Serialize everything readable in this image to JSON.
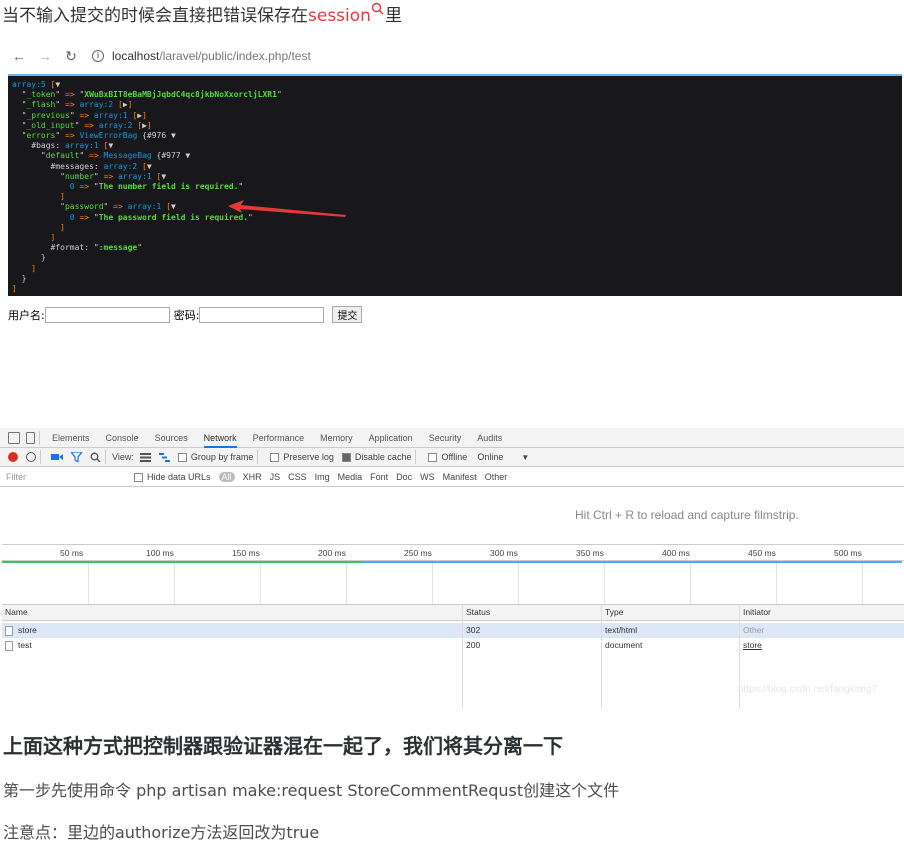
{
  "intro": {
    "text": "当不输入提交的时候会直接把错误保存在",
    "keyword": "session",
    "suffix": "里"
  },
  "browser": {
    "url_host": "localhost",
    "url_path": "/laravel/public/index.php/test"
  },
  "dump": {
    "lines": [
      [
        [
          "note",
          "array:5 "
        ],
        [
          "pun",
          "["
        ],
        [
          "wt",
          "▼"
        ]
      ],
      [
        [
          "wt",
          "  \""
        ],
        [
          "key",
          "_token"
        ],
        [
          "wt",
          "\" "
        ],
        [
          "op",
          "=>"
        ],
        [
          "wt",
          " \""
        ],
        [
          "str",
          "XWuBxBIT8eBaMBjJqbdC4qc8jkbNoXxorcljLXR1"
        ],
        [
          "wt",
          "\""
        ]
      ],
      [
        [
          "wt",
          "  \""
        ],
        [
          "key",
          "_flash"
        ],
        [
          "wt",
          "\" "
        ],
        [
          "op",
          "=>"
        ],
        [
          "note",
          " array:2 "
        ],
        [
          "pun",
          "["
        ],
        [
          "wt",
          "▶"
        ],
        [
          "pun",
          "]"
        ]
      ],
      [
        [
          "wt",
          "  \""
        ],
        [
          "key",
          "_previous"
        ],
        [
          "wt",
          "\" "
        ],
        [
          "op",
          "=>"
        ],
        [
          "note",
          " array:1 "
        ],
        [
          "pun",
          "["
        ],
        [
          "wt",
          "▶"
        ],
        [
          "pun",
          "]"
        ]
      ],
      [
        [
          "wt",
          "  \""
        ],
        [
          "key",
          "_old_input"
        ],
        [
          "wt",
          "\" "
        ],
        [
          "op",
          "=>"
        ],
        [
          "note",
          " array:2 "
        ],
        [
          "pun",
          "["
        ],
        [
          "wt",
          "▶"
        ],
        [
          "pun",
          "]"
        ]
      ],
      [
        [
          "wt",
          "  \""
        ],
        [
          "key",
          "errors"
        ],
        [
          "wt",
          "\" "
        ],
        [
          "op",
          "=>"
        ],
        [
          "note",
          " ViewErrorBag "
        ],
        [
          "wt",
          "{#976 ▼"
        ]
      ],
      [
        [
          "wt",
          "    #bags: "
        ],
        [
          "note",
          "array:1 "
        ],
        [
          "pun",
          "["
        ],
        [
          "wt",
          "▼"
        ]
      ],
      [
        [
          "wt",
          "      \""
        ],
        [
          "key",
          "default"
        ],
        [
          "wt",
          "\" "
        ],
        [
          "op",
          "=>"
        ],
        [
          "note",
          " MessageBag "
        ],
        [
          "wt",
          "{#977 ▼"
        ]
      ],
      [
        [
          "wt",
          "        #messages: "
        ],
        [
          "note",
          "array:2 "
        ],
        [
          "pun",
          "["
        ],
        [
          "wt",
          "▼"
        ]
      ],
      [
        [
          "wt",
          "          \""
        ],
        [
          "key",
          "number"
        ],
        [
          "wt",
          "\" "
        ],
        [
          "op",
          "=>"
        ],
        [
          "note",
          " array:1 "
        ],
        [
          "pun",
          "["
        ],
        [
          "wt",
          "▼"
        ]
      ],
      [
        [
          "num",
          "            0 "
        ],
        [
          "op",
          "=>"
        ],
        [
          "wt",
          " \""
        ],
        [
          "str",
          "The number field is required."
        ],
        [
          "wt",
          "\""
        ]
      ],
      [
        [
          "pun",
          "          ]"
        ]
      ],
      [
        [
          "wt",
          "          \""
        ],
        [
          "key",
          "password"
        ],
        [
          "wt",
          "\" "
        ],
        [
          "op",
          "=>"
        ],
        [
          "note",
          " array:1 "
        ],
        [
          "pun",
          "["
        ],
        [
          "wt",
          "▼"
        ]
      ],
      [
        [
          "num",
          "            0 "
        ],
        [
          "op",
          "=>"
        ],
        [
          "wt",
          " \""
        ],
        [
          "str",
          "The password field is required."
        ],
        [
          "wt",
          "\""
        ]
      ],
      [
        [
          "pun",
          "          ]"
        ]
      ],
      [
        [
          "pun",
          "        ]"
        ]
      ],
      [
        [
          "wt",
          "        #format: \""
        ],
        [
          "str",
          ":message"
        ],
        [
          "wt",
          "\""
        ]
      ],
      [
        [
          "wt",
          "      }"
        ]
      ],
      [
        [
          "pun",
          "    ]"
        ]
      ],
      [
        [
          "wt",
          "  }"
        ]
      ],
      [
        [
          "pun",
          "]"
        ]
      ]
    ]
  },
  "form": {
    "username_label": "用户名:",
    "password_label": "密码:",
    "submit_label": "提交",
    "username_value": "",
    "password_value": ""
  },
  "devtools": {
    "tabs": [
      "Elements",
      "Console",
      "Sources",
      "Network",
      "Performance",
      "Memory",
      "Application",
      "Security",
      "Audits"
    ],
    "active_tab": "Network",
    "toolbar": {
      "view_label": "View:",
      "group_by_frame": "Group by frame",
      "preserve_log": "Preserve log",
      "disable_cache": "Disable cache",
      "offline": "Offline",
      "throttle": "Online"
    },
    "filter": {
      "placeholder": "Filter",
      "hide_data_urls": "Hide data URLs",
      "types": [
        "All",
        "XHR",
        "JS",
        "CSS",
        "Img",
        "Media",
        "Font",
        "Doc",
        "WS",
        "Manifest",
        "Other"
      ]
    },
    "filmstrip_msg": "Hit Ctrl + R to reload and capture filmstrip.",
    "ticks": [
      "50 ms",
      "100 ms",
      "150 ms",
      "200 ms",
      "250 ms",
      "300 ms",
      "350 ms",
      "400 ms",
      "450 ms",
      "500 ms"
    ],
    "columns": [
      "Name",
      "Status",
      "Type",
      "Initiator"
    ],
    "rows": [
      {
        "name": "store",
        "status": "302",
        "type": "text/html",
        "initiator": "Other"
      },
      {
        "name": "test",
        "status": "200",
        "type": "document",
        "initiator": "store"
      }
    ],
    "watermark": "https://blog.csdn.net/fangkang7"
  },
  "heading": "上面这种方式把控制器跟验证器混在一起了，我们将其分离一下",
  "para1": "第一步先使用命令 php artisan make:request StoreCommentRequst创建这个文件",
  "para2": "注意点：里边的authorize方法返回改为true",
  "colors": {
    "keyword": "#e4393c",
    "dump_bg": "#18171b",
    "dump_key": "#56db3a",
    "dump_note": "#1299da",
    "dump_op": "#ff8400",
    "record": "#d93025",
    "arrow": "#e53935"
  }
}
